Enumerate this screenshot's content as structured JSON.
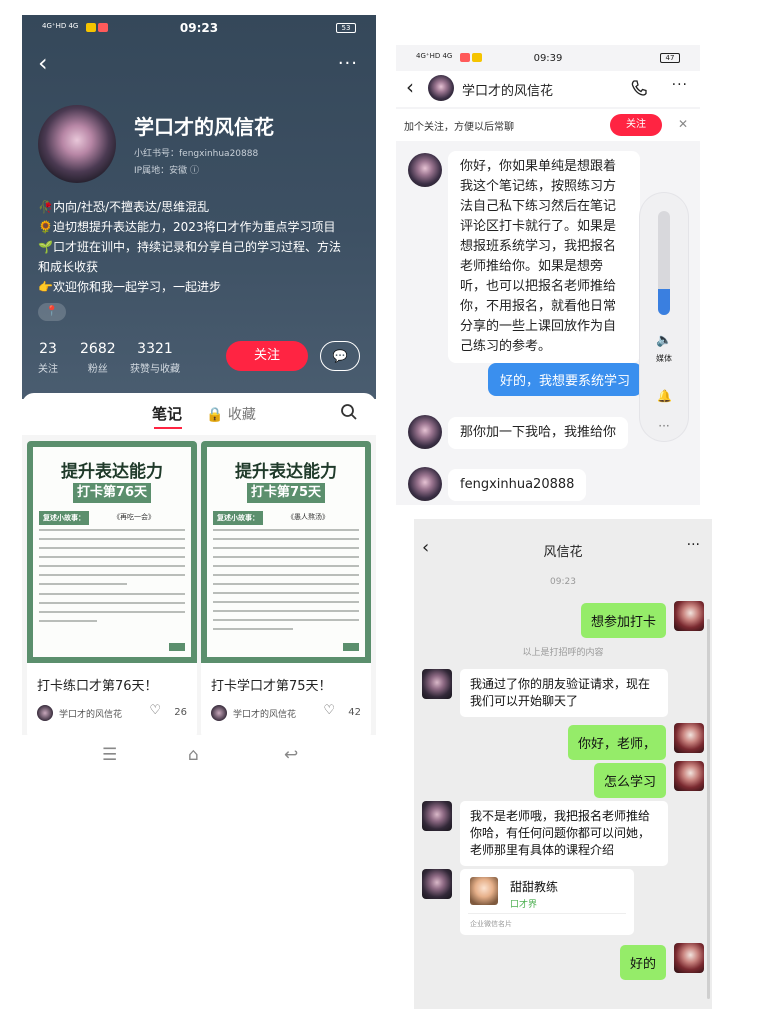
{
  "profile": {
    "status": {
      "signal": "4G⁺HD 4G",
      "time": "09:23",
      "battery": "53"
    },
    "nickname": "学口才的风信花",
    "red_id": "小红书号：fengxinhua20888",
    "ip": "IP属地：安徽 ⓘ",
    "bio": [
      "🥀内向/社恐/不擅表达/思维混乱",
      "🌻迫切想提升表达能力，2023将口才作为重点学习项目",
      "🌱口才班在训中，持续记录和分享自己的学习过程、方法",
      "和成长收获",
      "👉欢迎你和我一起学习，一起进步"
    ],
    "tag_icon": "📍",
    "stats": [
      {
        "num": "23",
        "label": "关注"
      },
      {
        "num": "2682",
        "label": "粉丝"
      },
      {
        "num": "3321",
        "label": "获赞与收藏"
      }
    ],
    "follow_label": "关注",
    "message_icon": "💬",
    "tabs": {
      "notes": "笔记",
      "favorites": "🔒 收藏"
    },
    "cards": [
      {
        "cover_title": "提升表达能力",
        "cover_day": "打卡第76天",
        "chip": "复述小故事：",
        "story": "《再吃一会》",
        "title": "打卡练口才第76天！",
        "author": "学口才的风信花",
        "likes": "26"
      },
      {
        "cover_title": "提升表达能力",
        "cover_day": "打卡第75天",
        "chip": "复述小故事：",
        "story": "《愚人熬汤》",
        "title": "打卡学口才第75天！",
        "author": "学口才的风信花",
        "likes": "42"
      }
    ],
    "nav": [
      "☰",
      "⌂",
      "↩"
    ]
  },
  "chat1": {
    "status": {
      "signal": "4G⁺HD 4G",
      "time": "09:39",
      "battery": "47"
    },
    "name": "学口才的风信花",
    "banner_text": "加个关注，方便以后常聊",
    "banner_btn": "关注",
    "banner_close": "✕",
    "messages": [
      {
        "from": "them",
        "text": "你好，你如果单纯是想跟着我这个笔记练，按照练习方法自己私下练习然后在笔记评论区打卡就行了。如果是想报班系统学习，我把报名老师推给你。如果是想旁听，也可以把报名老师推给你，不用报名，就看他日常分享的一些上课回放作为自己练习的参考。"
      },
      {
        "from": "me",
        "text": "好的，我想要系统学习"
      },
      {
        "from": "them",
        "text": "那你加一下我哈，我推给你"
      },
      {
        "from": "them",
        "text": "fengxinhua20888"
      }
    ],
    "volume": {
      "level": 0.25,
      "label": "媒体"
    }
  },
  "chat2": {
    "title": "风信花",
    "time": "09:23",
    "system_note": "以上是打招呼的内容",
    "messages": [
      {
        "from": "me",
        "text": "想参加打卡"
      },
      {
        "from": "them",
        "text": "我通过了你的朋友验证请求，现在我们可以开始聊天了"
      },
      {
        "from": "me",
        "text": "你好，老师，"
      },
      {
        "from": "me",
        "text": "怎么学习"
      },
      {
        "from": "them",
        "text": "我不是老师哦，我把报名老师推给你哈，有任何问题你都可以问她，老师那里有具体的课程介绍"
      },
      {
        "from": "me",
        "text": "好的"
      }
    ],
    "contact_card": {
      "name": "甜甜教练",
      "sub": "口才界",
      "footer": "企业微信名片"
    }
  }
}
